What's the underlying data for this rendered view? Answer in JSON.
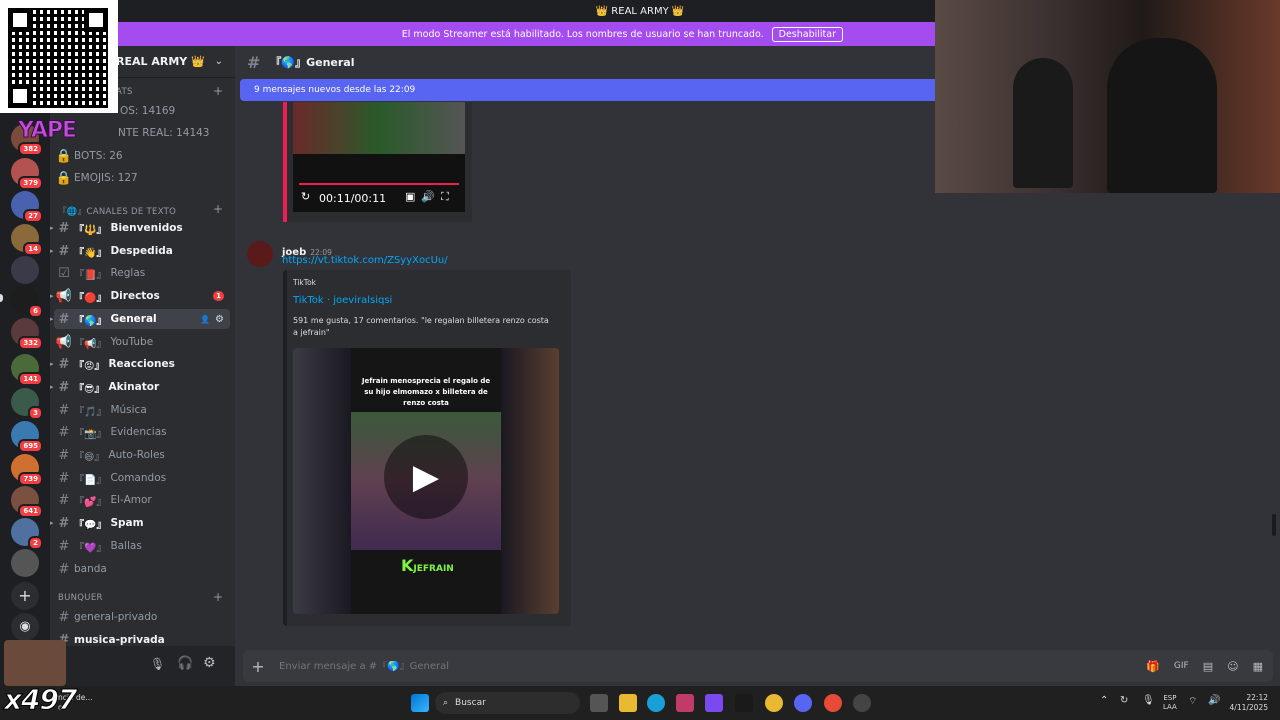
{
  "title_bar": {
    "title": "👑 REAL ARMY 👑"
  },
  "streamer_banner": {
    "message": "El modo Streamer está habilitado. Los nombres de usuario se han truncado.",
    "button": "Deshabilitar"
  },
  "server": {
    "name": "REAL ARMY 👑"
  },
  "stats": {
    "category": "ATS",
    "members": "OS: 14169",
    "real": "NTE REAL: 14143",
    "bots": "BOTS: 26",
    "emojis": "EMOJIS: 127"
  },
  "server_badges": [
    "382",
    "379",
    "27",
    "14",
    "6",
    "332",
    "141",
    "3",
    "695",
    "739",
    "641",
    "2"
  ],
  "categories": {
    "text": "『🌐』CANALES DE TEXTO",
    "bunker": "BUNQUER"
  },
  "channels": [
    {
      "emoji": "🔱",
      "name": "Bienvenidos",
      "icon": "#",
      "bold": true
    },
    {
      "emoji": "👋",
      "name": "Despedida",
      "icon": "#",
      "bold": true
    },
    {
      "emoji": "📕",
      "name": "Reglas",
      "icon": "☑",
      "bold": false
    },
    {
      "emoji": "🔴",
      "name": "Directos",
      "icon": "📢",
      "bold": true,
      "mentions": "1"
    },
    {
      "emoji": "🌎",
      "name": "General",
      "icon": "#",
      "bold": true,
      "selected": true
    },
    {
      "emoji": "📢",
      "name": "YouTube",
      "icon": "📢",
      "bold": false
    },
    {
      "emoji": "😡",
      "name": "Reacciones",
      "icon": "#",
      "bold": true
    },
    {
      "emoji": "😎",
      "name": "Akinator",
      "icon": "#",
      "bold": true
    },
    {
      "emoji": "🎵",
      "name": "Música",
      "icon": "#",
      "bold": false
    },
    {
      "emoji": "📸",
      "name": "Evidencias",
      "icon": "#",
      "bold": false
    },
    {
      "emoji": "😄",
      "name": "Auto-Roles",
      "icon": "#",
      "bold": false
    },
    {
      "emoji": "📄",
      "name": "Comandos",
      "icon": "#",
      "bold": false
    },
    {
      "emoji": "💕",
      "name": "El-Amor",
      "icon": "#",
      "bold": false
    },
    {
      "emoji": "💬",
      "name": "Spam",
      "icon": "#",
      "bold": true
    },
    {
      "emoji": "💜",
      "name": "Ballas",
      "icon": "#",
      "bold": false
    },
    {
      "emoji": "",
      "name": "banda",
      "icon": "#",
      "bold": false
    }
  ],
  "bunker_channels": [
    {
      "name": "general-privado"
    },
    {
      "name": "musica-privada"
    }
  ],
  "chat": {
    "channel_title": "『🌎』General",
    "new_messages": "9 mensajes nuevos desde las 22:09",
    "video_time": "00:11/00:11",
    "message": {
      "author": "joeb",
      "time": "22:09",
      "link": "https://vt.tiktok.com/ZSyyXocUu/",
      "embed_provider": "TikTok",
      "embed_title": "TikTok · joeviralsiqsi",
      "embed_desc": "591 me gusta, 17 comentarios. \"le regalan billetera renzo costa a jefrain\"",
      "video_caption": "Jefrain menosprecia el regalo de su hijo elmomazo x billetera de renzo costa",
      "video_watermark": "JEFRAIN"
    }
  },
  "composer": {
    "placeholder": "Enviar mensaje a #『🌎』General"
  },
  "overlay": {
    "yape": "YAPE",
    "counter": "x497",
    "notification": "ncia de...",
    "notification2": "o"
  },
  "taskbar": {
    "search": "Buscar",
    "lang": "ESP",
    "lang2": "LAA",
    "time": "22:12",
    "date": "4/11/2025"
  },
  "colors": {
    "accent": "#5865f2",
    "streamer_banner": "#a44cf0",
    "mention_red": "#f23f43",
    "link": "#00a8fc"
  }
}
